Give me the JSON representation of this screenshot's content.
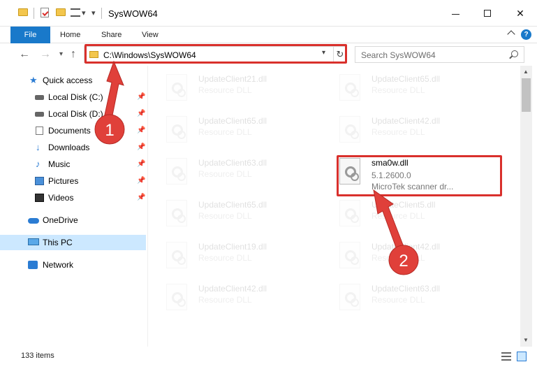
{
  "window": {
    "title": "SysWOW64",
    "qa_dropdown_glyph": "▾",
    "qa_customize_glyph": "▾",
    "minimize_glyph": "",
    "maximize_glyph": "",
    "close_glyph": "✕"
  },
  "ribbon": {
    "tabs": [
      "File",
      "Home",
      "Share",
      "View"
    ],
    "help_glyph": "?"
  },
  "nav": {
    "back_glyph": "←",
    "forward_glyph": "→",
    "recent_glyph": "▾",
    "up_glyph": "↑",
    "address": "C:\\Windows\\SysWOW64",
    "address_dropdown_glyph": "▾",
    "refresh_glyph": "↻",
    "search_placeholder": "Search SysWOW64"
  },
  "sidebar": {
    "pin_glyph": "📌",
    "items": [
      {
        "label": "Quick access",
        "icon": "star-icon"
      },
      {
        "label": "Local Disk (C:)",
        "icon": "disk-icon",
        "pinned": true
      },
      {
        "label": "Local Disk (D:)",
        "icon": "disk-icon",
        "pinned": true
      },
      {
        "label": "Documents",
        "icon": "documents-icon",
        "pinned": true
      },
      {
        "label": "Downloads",
        "icon": "downloads-icon",
        "pinned": true
      },
      {
        "label": "Music",
        "icon": "music-icon",
        "pinned": true
      },
      {
        "label": "Pictures",
        "icon": "pictures-icon",
        "pinned": true
      },
      {
        "label": "Videos",
        "icon": "videos-icon",
        "pinned": true
      },
      {
        "label": "OneDrive",
        "icon": "onedrive-icon"
      },
      {
        "label": "This PC",
        "icon": "this-pc-icon",
        "selected": true
      },
      {
        "label": "Network",
        "icon": "network-icon"
      }
    ]
  },
  "files": [
    {
      "name": "UpdateClient21.dll",
      "type": "Resource DLL",
      "faded": true
    },
    {
      "name": "UpdateClient65.dll",
      "type": "Resource DLL",
      "faded": true
    },
    {
      "name": "UpdateClient65.dll",
      "type": "Resource DLL",
      "faded": true
    },
    {
      "name": "UpdateClient42.dll",
      "type": "Resource DLL",
      "faded": true
    },
    {
      "name": "UpdateClient63.dll",
      "type": "Resource DLL",
      "faded": true
    },
    {
      "name": "sma0w.dll",
      "version": "5.1.2600.0",
      "description": "MicroTek scanner dr...",
      "faded": false
    },
    {
      "name": "UpdateClient65.dll",
      "type": "Resource DLL",
      "faded": true
    },
    {
      "name": "UpdateClient5.dll",
      "type": "Resource DLL",
      "faded": true
    },
    {
      "name": "UpdateClient19.dll",
      "type": "Resource DLL",
      "faded": true
    },
    {
      "name": "UpdateClient42.dll",
      "type": "Resource DLL",
      "faded": true
    },
    {
      "name": "UpdateClient42.dll",
      "type": "Resource DLL",
      "faded": true
    },
    {
      "name": "UpdateClient63.dll",
      "type": "Resource DLL",
      "faded": true
    }
  ],
  "scrollbar": {
    "up_glyph": "▲",
    "down_glyph": "▼"
  },
  "status": {
    "item_count": "133 items"
  },
  "annotations": [
    {
      "number": "1"
    },
    {
      "number": "2"
    }
  ],
  "colors": {
    "accent": "#1979ca",
    "highlight": "#d9302c",
    "selection": "#cce8ff"
  }
}
